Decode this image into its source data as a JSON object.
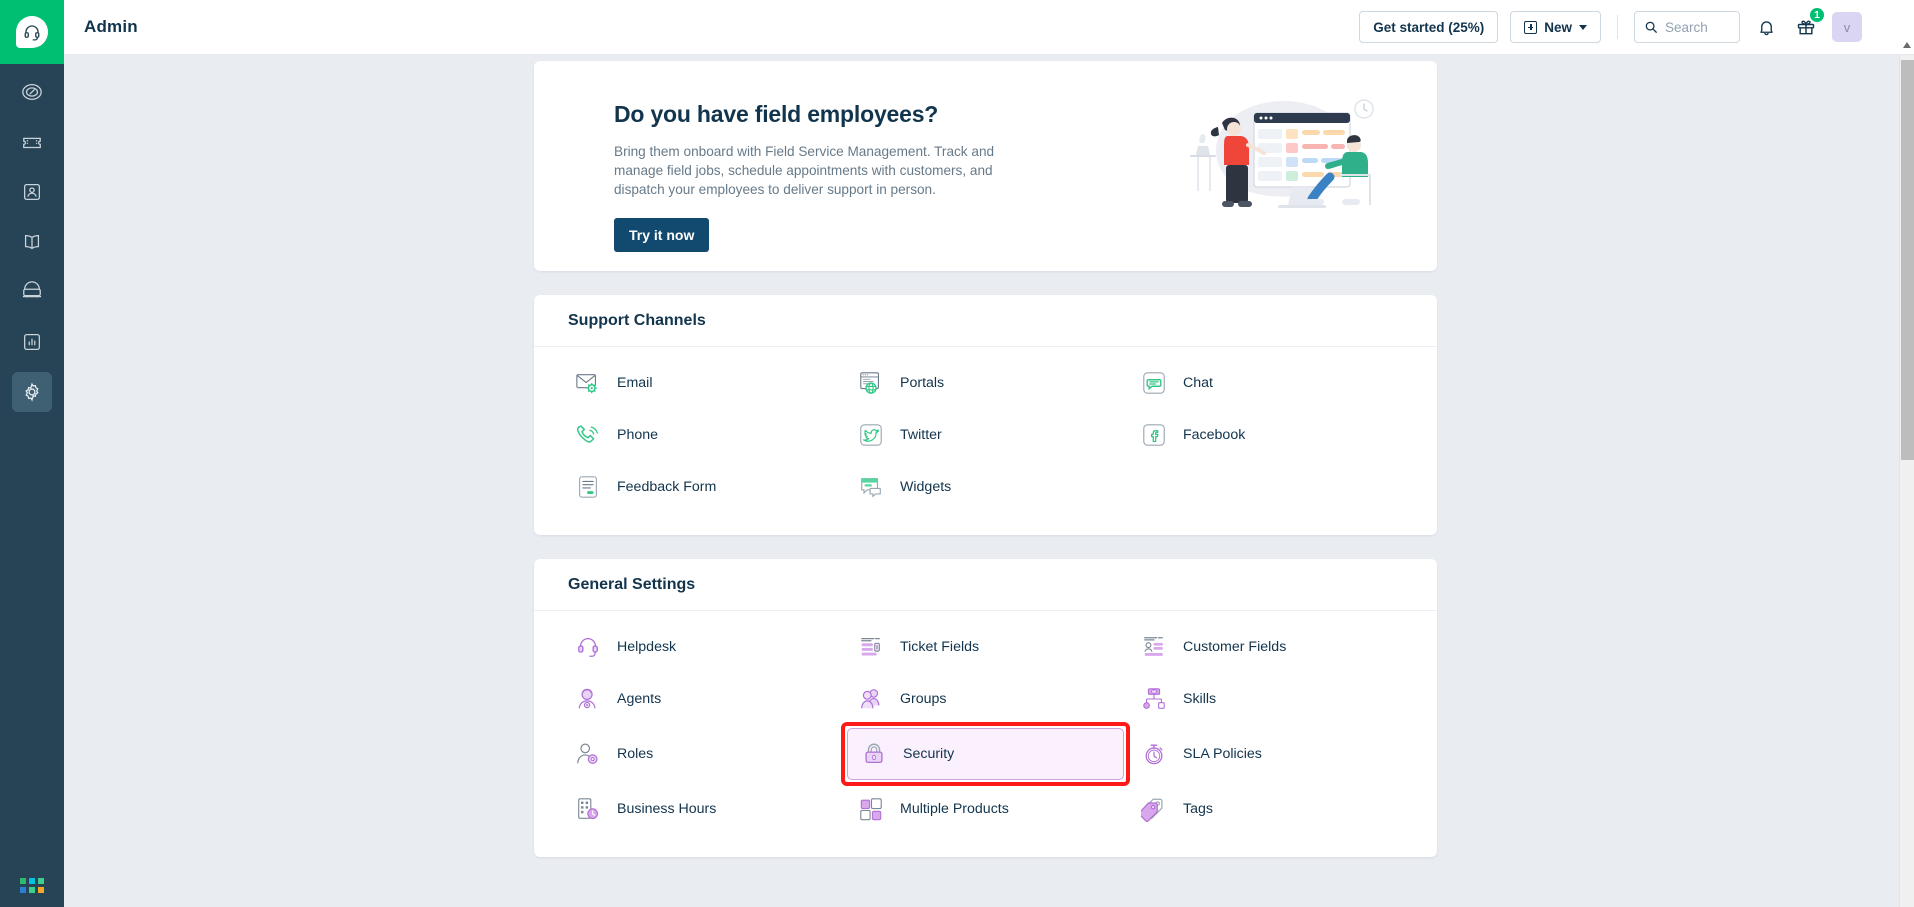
{
  "theme": {
    "brand_green": "#00bf72",
    "rail_bg": "#264456",
    "page_bg": "#e9ecf1",
    "text_dark": "#12344d",
    "channel_icon": "#32c787",
    "settings_icon": "#b06fd6",
    "highlight_red": "#ff1a1a"
  },
  "rail": {
    "logo_name": "freshdesk-logo",
    "items": [
      {
        "name": "dashboard-icon",
        "label": "Dashboard",
        "active": false
      },
      {
        "name": "tickets-icon",
        "label": "Tickets",
        "active": false
      },
      {
        "name": "contacts-icon",
        "label": "Contacts",
        "active": false
      },
      {
        "name": "solutions-icon",
        "label": "Solutions",
        "active": false
      },
      {
        "name": "social-icon",
        "label": "Social",
        "active": false
      },
      {
        "name": "analytics-icon",
        "label": "Analytics",
        "active": false
      },
      {
        "name": "admin-gear-icon",
        "label": "Admin",
        "active": true
      }
    ],
    "app_switcher": {
      "name": "app-switcher-icon",
      "colors": [
        "#2eb872",
        "#00c2e0",
        "#3ecf8e",
        "#2b7fd4",
        "#3ecf8e",
        "#f5a623"
      ]
    }
  },
  "topbar": {
    "title": "Admin",
    "get_started_label": "Get started (25%)",
    "new_label": "New",
    "search_placeholder": "Search",
    "search_value": "",
    "gift_badge": "1",
    "avatar_initial": "v"
  },
  "banner": {
    "title": "Do you have field employees?",
    "description": "Bring them onboard with Field Service Management. Track and manage field jobs, schedule appointments with customers, and dispatch your employees to deliver support in person.",
    "cta_label": "Try it now"
  },
  "support_channels": {
    "heading": "Support Channels",
    "items": [
      {
        "label": "Email",
        "icon": "email-icon"
      },
      {
        "label": "Portals",
        "icon": "portals-icon"
      },
      {
        "label": "Chat",
        "icon": "chat-icon"
      },
      {
        "label": "Phone",
        "icon": "phone-icon"
      },
      {
        "label": "Twitter",
        "icon": "twitter-icon"
      },
      {
        "label": "Facebook",
        "icon": "facebook-icon"
      },
      {
        "label": "Feedback Form",
        "icon": "feedback-form-icon"
      },
      {
        "label": "Widgets",
        "icon": "widgets-icon"
      },
      {
        "label": "",
        "icon": ""
      }
    ]
  },
  "general_settings": {
    "heading": "General Settings",
    "items": [
      {
        "label": "Helpdesk",
        "icon": "helpdesk-icon",
        "selected": false
      },
      {
        "label": "Ticket Fields",
        "icon": "ticket-fields-icon",
        "selected": false
      },
      {
        "label": "Customer Fields",
        "icon": "customer-fields-icon",
        "selected": false
      },
      {
        "label": "Agents",
        "icon": "agents-icon",
        "selected": false
      },
      {
        "label": "Groups",
        "icon": "groups-icon",
        "selected": false
      },
      {
        "label": "Skills",
        "icon": "skills-icon",
        "selected": false
      },
      {
        "label": "Roles",
        "icon": "roles-icon",
        "selected": false
      },
      {
        "label": "Security",
        "icon": "security-lock-icon",
        "selected": true
      },
      {
        "label": "SLA Policies",
        "icon": "sla-policies-icon",
        "selected": false
      },
      {
        "label": "Business Hours",
        "icon": "business-hours-icon",
        "selected": false
      },
      {
        "label": "Multiple Products",
        "icon": "multiple-products-icon",
        "selected": false
      },
      {
        "label": "Tags",
        "icon": "tags-icon",
        "selected": false
      }
    ]
  }
}
